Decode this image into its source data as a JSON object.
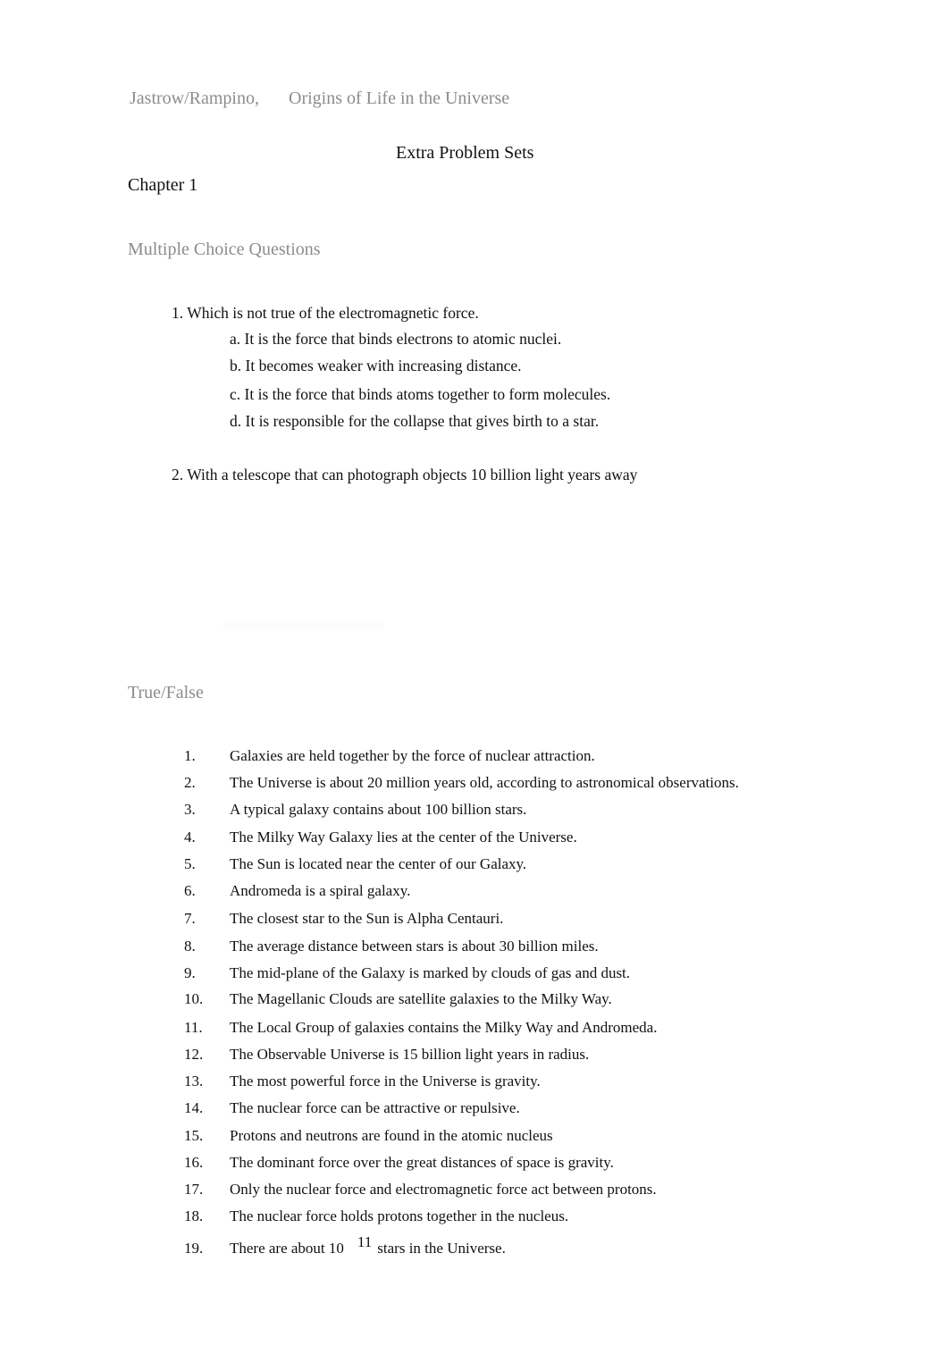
{
  "header": {
    "authors": "Jastrow/Rampino,",
    "book_title": "Origins of Life in the Universe"
  },
  "document_title": "Extra Problem Sets",
  "chapter": "Chapter 1",
  "multiple_choice": {
    "heading": "Multiple Choice Questions",
    "questions": [
      {
        "number": "1.",
        "text": "Which is not true of the electromagnetic force.",
        "options": [
          "a. It is the force that binds electrons to atomic nuclei.",
          "b. It becomes weaker with increasing distance.",
          "c. It is the force that binds atoms together to form molecules.",
          "d. It is responsible for the collapse that gives birth to a star."
        ]
      },
      {
        "number": "2.",
        "text": "With a telescope that can photograph objects 10 billion light years away",
        "options": []
      }
    ]
  },
  "true_false": {
    "heading": "True/False",
    "items": [
      {
        "number": "1.",
        "text": "Galaxies are held together by the force of nuclear attraction."
      },
      {
        "number": "2.",
        "text": "The Universe is about 20 million years old, according to astronomical observations."
      },
      {
        "number": "3.",
        "text": "A typical galaxy contains about 100 billion stars."
      },
      {
        "number": "4.",
        "text": "The Milky Way Galaxy lies at the center of the Universe."
      },
      {
        "number": "5.",
        "text": "The Sun is located near the center of our Galaxy."
      },
      {
        "number": "6.",
        "text": "Andromeda is a spiral galaxy."
      },
      {
        "number": "7.",
        "text": "The closest star to the Sun is Alpha Centauri."
      },
      {
        "number": "8.",
        "text": "The average distance between stars is about 30 billion miles."
      },
      {
        "number": "9.",
        "text": "The mid-plane of the Galaxy is marked by clouds of gas and dust."
      },
      {
        "number": "10.",
        "text": "The Magellanic Clouds are satellite galaxies to the Milky Way."
      },
      {
        "number": "11.",
        "text": "The Local Group of galaxies contains the Milky Way and Andromeda."
      },
      {
        "number": "12.",
        "text": "The Observable Universe is 15 billion light years in radius."
      },
      {
        "number": "13.",
        "text": "The most powerful force in the Universe is gravity."
      },
      {
        "number": "14.",
        "text": "The nuclear force can be attractive or repulsive."
      },
      {
        "number": "15.",
        "text": "Protons and neutrons are found in the atomic nucleus"
      },
      {
        "number": "16.",
        "text": "The dominant force over the great distances of space is gravity."
      },
      {
        "number": "17.",
        "text": "Only the nuclear force and electromagnetic force act between protons."
      },
      {
        "number": "18.",
        "text": "The nuclear force holds protons together in the nucleus."
      }
    ],
    "item_19": {
      "number": "19.",
      "text_before": "There are about 10",
      "exponent": "11",
      "text_after": "stars in the Universe."
    }
  }
}
